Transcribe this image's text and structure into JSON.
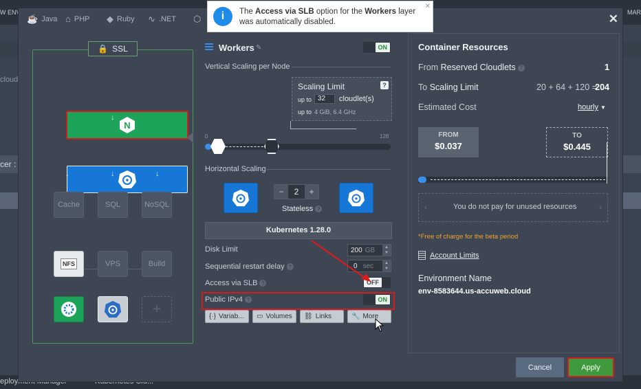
{
  "background": {
    "env_label": "W ENV",
    "mar_label": "MAR",
    "cloud_label": "cloud",
    "cer_label": "cer :",
    "bottom_tabs": [
      "eployment Manager",
      "Kubernetes Clu..."
    ]
  },
  "notification": {
    "text_pre": "The ",
    "bold1": "Access via SLB",
    "text_mid": " option for the ",
    "bold2": "Workers",
    "text_post": " layer was automatically disabled."
  },
  "tech_tabs": [
    "Java",
    "PHP",
    "Ruby",
    ".NET"
  ],
  "topology": {
    "ssl_label": "SSL",
    "nodes": [
      "Cache",
      "SQL",
      "NoSQL",
      "VPS",
      "Build"
    ],
    "nfs_label": "NFS"
  },
  "workers": {
    "title": "Workers",
    "toggle_on": "ON",
    "vertical_label": "Vertical Scaling per Node",
    "scaling_limit_title": "Scaling Limit",
    "scaling_upto": "up to",
    "scaling_value": "32",
    "scaling_unit": "cloudlet(s)",
    "scaling_upto2": "up to",
    "scaling_res": "4 GiB, 6.4 GHz",
    "slider_min": "0",
    "slider_max": "128",
    "horizontal_label": "Horizontal Scaling",
    "node_count": "2",
    "stepper_minus": "−",
    "stepper_plus": "+",
    "stateless_label": "Stateless",
    "version_label": "Kubernetes 1.28.0",
    "disk_limit_label": "Disk Limit",
    "disk_value": "200",
    "disk_unit": "GB",
    "restart_label": "Sequential restart delay",
    "restart_value": "0",
    "restart_unit": "sec",
    "slb_label": "Access via SLB",
    "slb_toggle": "OFF",
    "ipv4_label": "Public IPv4",
    "ipv4_toggle": "ON",
    "buttons": [
      "Variab...",
      "Volumes",
      "Links",
      "More"
    ]
  },
  "resources": {
    "title": "Container Resources",
    "from_prefix": "From",
    "from_label": "Reserved Cloudlets",
    "from_value": "1",
    "to_prefix": "To",
    "to_label": "Scaling Limit",
    "to_formula": "20 + 64 + 120 =",
    "to_value": "204",
    "cost_label": "Estimated Cost",
    "cost_period": "hourly",
    "from_box_label": "FROM",
    "from_box_value": "$0.037",
    "to_box_label": "TO",
    "to_box_value": "$0.445",
    "unused_text": "You do not pay for unused resources",
    "free_note": "*Free of charge for the beta period",
    "account_limits": "Account Limits",
    "env_name_label": "Environment Name",
    "env_name_value": "env-8583644.us-accuweb.cloud"
  },
  "footer": {
    "cancel": "Cancel",
    "apply": "Apply"
  }
}
